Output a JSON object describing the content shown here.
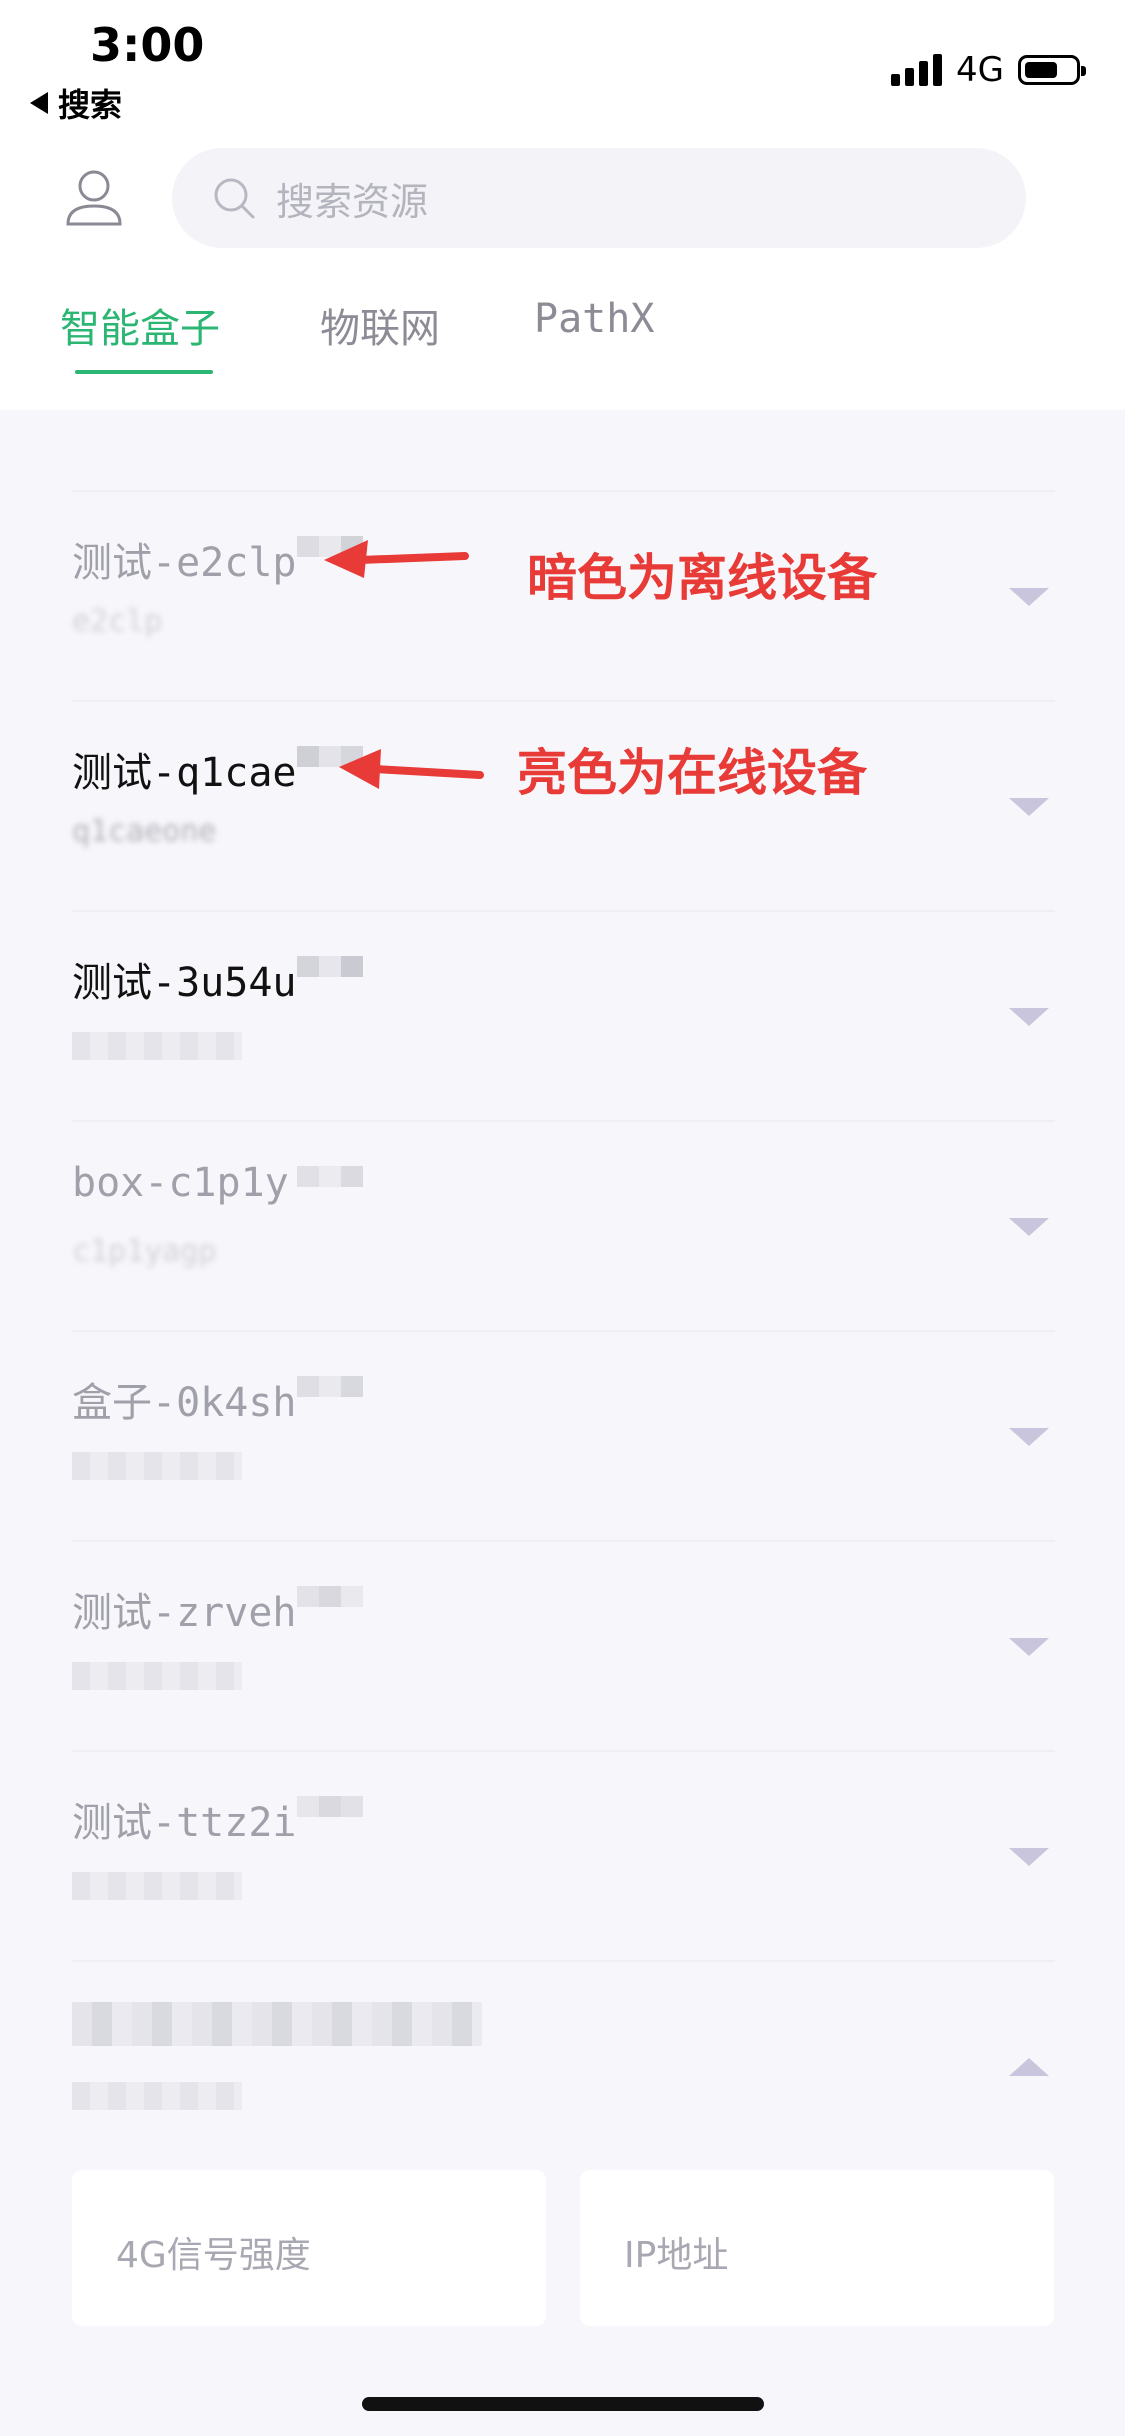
{
  "status_bar": {
    "time": "3:00",
    "back_label": "搜索",
    "network": "4G"
  },
  "header": {
    "search_placeholder": "搜索资源"
  },
  "tabs": [
    {
      "label": "智能盒子",
      "active": true
    },
    {
      "label": "物联网",
      "active": false
    },
    {
      "label": "PathX",
      "active": false
    }
  ],
  "devices": [
    {
      "name": "测试-e2clp",
      "sub": "e2clp",
      "status": "offline",
      "expanded": false
    },
    {
      "name": "测试-q1cae",
      "sub": "q1caeone",
      "status": "online",
      "expanded": false
    },
    {
      "name": "测试-3u54u",
      "sub": "",
      "status": "online",
      "expanded": false
    },
    {
      "name": "box-c1p1y",
      "sub": "c1p1yagp",
      "status": "offline",
      "expanded": false
    },
    {
      "name": "盒子-0k4sh",
      "sub": "",
      "status": "offline",
      "expanded": false
    },
    {
      "name": "测试-zrveh",
      "sub": "",
      "status": "offline",
      "expanded": false
    },
    {
      "name": "测试-ttz2i",
      "sub": "",
      "status": "offline",
      "expanded": false
    },
    {
      "name": "",
      "sub": "",
      "status": "offline",
      "expanded": true
    }
  ],
  "annotations": {
    "offline_note": "暗色为离线设备",
    "online_note": "亮色为在线设备"
  },
  "detail_cards": {
    "signal_label": "4G信号强度",
    "ip_label": "IP地址"
  },
  "colors": {
    "accent": "#2bb673",
    "annotation": "#e83a36",
    "chevron": "#c8c5dc"
  }
}
